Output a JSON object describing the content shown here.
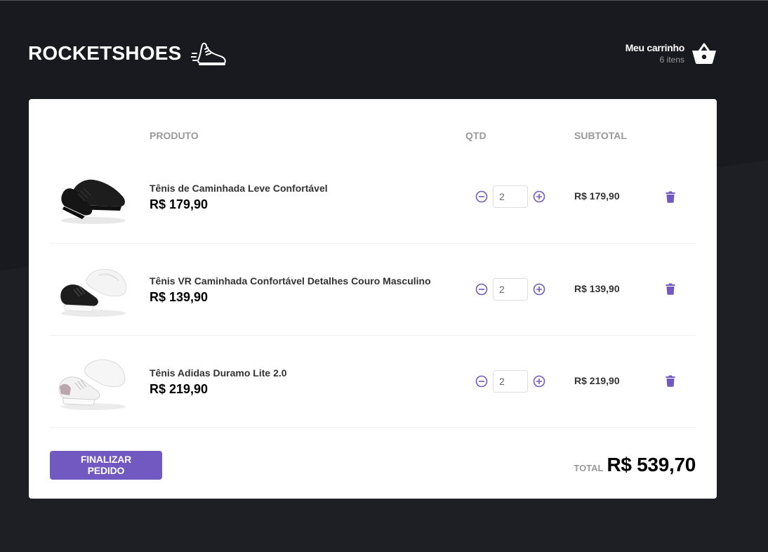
{
  "colors": {
    "accent": "#7159c1",
    "background": "#191920",
    "card": "#ffffff"
  },
  "header": {
    "logo_text": "ROCKETSHOES",
    "logo_icon": "running-shoe-icon",
    "cart_title": "Meu carrinho",
    "cart_count": "6 itens",
    "cart_icon": "basket-icon"
  },
  "table": {
    "headers": {
      "product": "PRODUTO",
      "qty": "QTD",
      "subtotal": "SUBTOTAL"
    },
    "items": [
      {
        "title": "Tênis de Caminhada Leve Confortável",
        "price": "R$ 179,90",
        "qty": "2",
        "subtotal": "R$ 179,90",
        "image": "black-sneaker"
      },
      {
        "title": "Tênis VR Caminhada Confortável Detalhes Couro Masculino",
        "price": "R$ 139,90",
        "qty": "2",
        "subtotal": "R$ 139,90",
        "image": "black-white-sneaker"
      },
      {
        "title": "Tênis Adidas Duramo Lite 2.0",
        "price": "R$ 219,90",
        "qty": "2",
        "subtotal": "R$ 219,90",
        "image": "white-sneaker"
      }
    ]
  },
  "footer": {
    "finish_label": "FINALIZAR PEDIDO",
    "total_label": "TOTAL",
    "total_value": "R$ 539,70"
  }
}
